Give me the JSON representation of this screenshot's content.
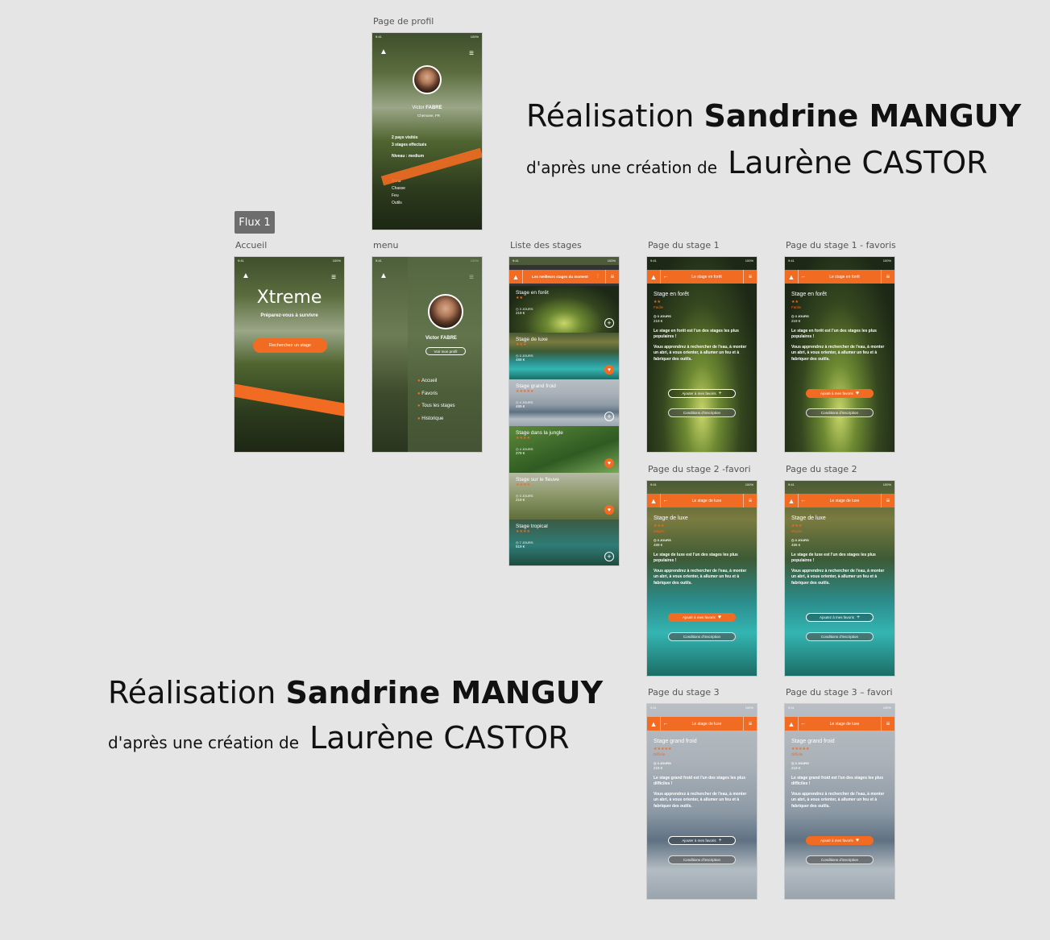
{
  "credits": {
    "top": {
      "line1_prefix": "Réalisation",
      "line1_name": "Sandrine MANGUY",
      "line2_prefix": "d'après une création de",
      "line2_name": "Laurène CASTOR"
    },
    "bottom": {
      "line1_prefix": "Réalisation",
      "line1_name": "Sandrine MANGUY",
      "line2_prefix": "d'après une création de",
      "line2_name": "Laurène CASTOR"
    }
  },
  "flux_label": "Flux 1",
  "status": {
    "time": "9:41",
    "date": "Mon Jun 22",
    "battery": "100%"
  },
  "frames": {
    "profile": {
      "label": "Page de profil",
      "name_first": "Victor",
      "name_last": "FABRE",
      "location": "Chemone, FR",
      "countries": "2 pays visités",
      "stages_done": "3 stages effectués",
      "level_label": "Niveau :",
      "level": "medium",
      "skills": [
        "Abris",
        "Chasse",
        "Feu",
        "Outils"
      ]
    },
    "home": {
      "label": "Accueil",
      "app_title": "Xtreme",
      "tagline": "Préparez-vous à survivre",
      "cta": "Recherchez un stage"
    },
    "menu": {
      "label": "menu",
      "user": "Victor FABRE",
      "profile_btn": "Voir mon profil",
      "items": [
        "Accueil",
        "Favoris",
        "Tous les stages",
        "Historique"
      ]
    },
    "list": {
      "label": "Liste des stages",
      "header": "Les meilleurs stages du moment",
      "items": [
        {
          "title": "Stage en forêt",
          "stars": "★★",
          "days": "3 JOURS",
          "price": "219 €",
          "action": "+"
        },
        {
          "title": "Stage de luxe",
          "stars": "★★★",
          "days": "3 JOURS",
          "price": "489 €",
          "action": "♥"
        },
        {
          "title": "Stage grand froid",
          "stars": "★★★★★",
          "days": "4 JOURS",
          "price": "489 €",
          "action": "+"
        },
        {
          "title": "Stage dans la jungle",
          "stars": "★★★★",
          "days": "4 JOURS",
          "price": "279 €",
          "action": "♥"
        },
        {
          "title": "Stage sur le fleuve",
          "stars": "★★★★",
          "days": "3 JOURS",
          "price": "219 €",
          "action": "♥"
        },
        {
          "title": "Stage tropical",
          "stars": "★★★★",
          "days": "7 JOURS",
          "price": "519 €",
          "action": "+"
        }
      ]
    },
    "stage1": {
      "label": "Page du stage 1",
      "header": "Le stage en forêt",
      "name": "Stage en forêt",
      "stars": "★★",
      "difficulty": "Facile",
      "days": "3 JOURS",
      "price": "219 €",
      "p1": "Le stage en forêt est l'un des stages les plus populaires !",
      "p2": "Vous apprendrez à rechercher de l'eau, à monter un abri, à vous orienter, à allumer un feu et à fabriquer des outils.",
      "fav_btn": "Ajouter à mes favoris",
      "fav_icon": "+",
      "cond_btn": "Conditions d'inscription"
    },
    "stage1_fav": {
      "label": "Page du stage 1 - favoris",
      "header": "Le stage en forêt",
      "name": "Stage en forêt",
      "stars": "★★",
      "difficulty": "Facile",
      "days": "3 JOURS",
      "price": "219 €",
      "p1": "Le stage en forêt est l'un des stages les plus populaires !",
      "p2": "Vous apprendrez à rechercher de l'eau, à monter un abri, à vous orienter, à allumer un feu et à fabriquer des outils.",
      "fav_btn": "Ajouté à mes favoris",
      "fav_icon": "♥",
      "cond_btn": "Conditions d'inscription"
    },
    "stage2_fav": {
      "label": "Page du stage 2 -favori",
      "header": "Le stage de luxe",
      "name": "Stage de luxe",
      "stars": "★★★",
      "difficulty": "Moyen",
      "days": "3 JOURS",
      "price": "489 €",
      "p1": "Le stage de luxe est l'un des stages les plus populaires !",
      "p2": "Vous apprendrez à rechercher de l'eau, à monter un abri, à vous orienter, à allumer un feu et à fabriquer des outils.",
      "fav_btn": "Ajouté à mes favoris",
      "fav_icon": "♥",
      "cond_btn": "Conditions d'inscription"
    },
    "stage2": {
      "label": "Page du stage 2",
      "header": "Le stage de luxe",
      "name": "Stage de luxe",
      "stars": "★★★",
      "difficulty": "Moyen",
      "days": "3 JOURS",
      "price": "489 €",
      "p1": "Le stage de luxe est l'un des stages les plus populaires !",
      "p2": "Vous apprendrez à rechercher de l'eau, à monter un abri, à vous orienter, à allumer un feu et à fabriquer des outils.",
      "fav_btn": "Ajoutez à mes favoris",
      "fav_icon": "+",
      "cond_btn": "Conditions d'inscription"
    },
    "stage3": {
      "label": "Page du stage 3",
      "header": "Le stage de luxe",
      "name": "Stage grand froid",
      "stars": "★★★★★",
      "difficulty": "Difficile",
      "days": "3 JOURS",
      "price": "219 €",
      "p1": "Le stage grand froid est l'un des stages les plus difficiles !",
      "p2": "Vous apprendrez à rechercher de l'eau, à monter un abri, à vous orienter, à allumer un feu et à fabriquer des outils.",
      "fav_btn": "Ajouter à mes favoris",
      "fav_icon": "+",
      "cond_btn": "Conditions d'inscription"
    },
    "stage3_fav": {
      "label": "Page du stage 3 – favori",
      "header": "Le stage de luxe",
      "name": "Stage grand froid",
      "stars": "★★★★★",
      "difficulty": "Difficile",
      "days": "3 JOURS",
      "price": "219 €",
      "p1": "Le stage grand froid est l'un des stages les plus difficiles !",
      "p2": "Vous apprendrez à rechercher de l'eau, à monter un abri, à vous orienter, à allumer un feu et à fabriquer des outils.",
      "fav_btn": "Ajouté à mes favoris",
      "fav_icon": "♥",
      "cond_btn": "Conditions d'inscription"
    }
  },
  "colors": {
    "accent": "#f26b22",
    "background": "#e5e5e5"
  }
}
